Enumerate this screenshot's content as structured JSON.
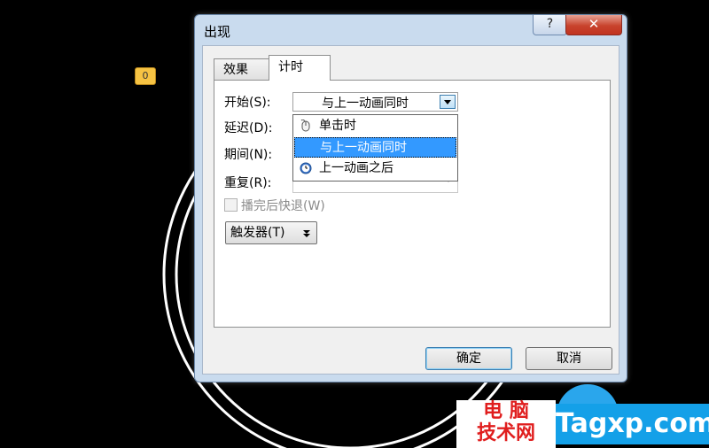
{
  "canvas": {
    "anim_tag": "0"
  },
  "dialog": {
    "title": "出现",
    "help_label": "?",
    "close_label": "✕",
    "tabs": [
      {
        "label": "效果"
      },
      {
        "label": "计时"
      }
    ],
    "fields": {
      "start": {
        "label": "开始(S):",
        "value": "与上一动画同时"
      },
      "delay": {
        "label": "延迟(D):"
      },
      "duration": {
        "label": "期间(N):"
      },
      "repeat": {
        "label": "重复(R):"
      }
    },
    "dropdown_options": [
      {
        "label": "单击时",
        "icon": "mouse-icon"
      },
      {
        "label": "与上一动画同时",
        "icon": "none",
        "selected": true
      },
      {
        "label": "上一动画之后",
        "icon": "clock-icon"
      }
    ],
    "rewind_checkbox": {
      "label": "播完后快退(W)",
      "checked": false,
      "disabled": true
    },
    "trigger_button": {
      "label": "触发器(T)"
    },
    "ok_label": "确定",
    "cancel_label": "取消"
  },
  "watermark": {
    "cn_line1": "电 脑",
    "cn_line2": "技术网",
    "en": "Tagxp.com"
  },
  "colors": {
    "selection": "#3399ff",
    "dialog_frame": "#c9dbee",
    "close_button": "#c8432d",
    "watermark_red": "#e01e1e",
    "watermark_blue": "#14a0e8"
  }
}
